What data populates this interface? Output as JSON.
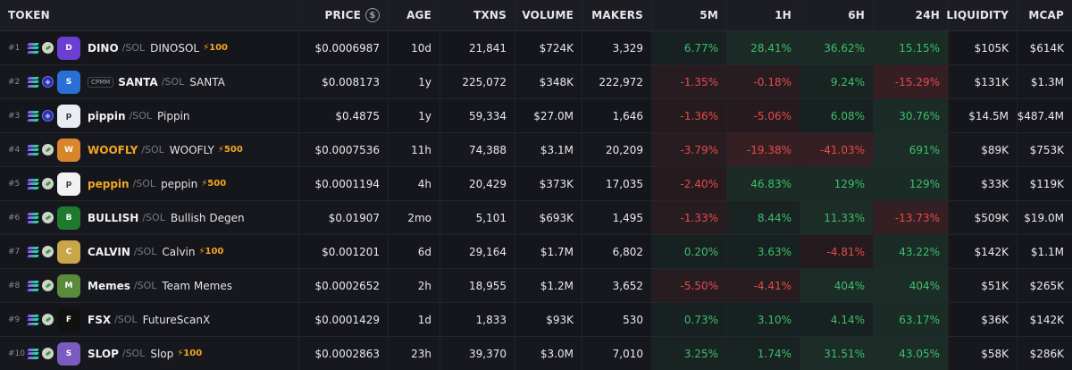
{
  "headers": {
    "token": "TOKEN",
    "price": "PRICE",
    "price_icon": "$",
    "age": "AGE",
    "txns": "TXNS",
    "volume": "VOLUME",
    "makers": "MAKERS",
    "m5": "5M",
    "h1": "1H",
    "h6": "6H",
    "h24": "24H",
    "liquidity": "LIQUIDITY",
    "mcap": "MCAP"
  },
  "rows": [
    {
      "rank": "#1",
      "dex": "pump",
      "cpmm": "",
      "symbol": "DINO",
      "chain": "/SOL",
      "name": "DINOSOL",
      "boost": "⚡100",
      "logo_color": "#6b3fd1",
      "logo_text": "D",
      "price": "$0.0006987",
      "age": "10d",
      "txns": "21,841",
      "volume": "$724K",
      "makers": "3,329",
      "m5": "6.77%",
      "h1": "28.41%",
      "h6": "36.62%",
      "h24": "15.15%",
      "liquidity": "$105K",
      "mcap": "$614K"
    },
    {
      "rank": "#2",
      "dex": "raydium",
      "cpmm": "CPMM",
      "symbol": "SANTA",
      "chain": "/SOL",
      "name": "SANTA",
      "boost": "",
      "logo_color": "#2a6fd6",
      "logo_text": "S",
      "price": "$0.008173",
      "age": "1y",
      "txns": "225,072",
      "volume": "$348K",
      "makers": "222,972",
      "m5": "-1.35%",
      "h1": "-0.18%",
      "h6": "9.24%",
      "h24": "-15.29%",
      "liquidity": "$131K",
      "mcap": "$1.3M"
    },
    {
      "rank": "#3",
      "dex": "raydium",
      "cpmm": "",
      "symbol": "pippin",
      "chain": "/SOL",
      "name": "Pippin",
      "boost": "",
      "logo_color": "#e9edf2",
      "logo_text": "p",
      "price": "$0.4875",
      "age": "1y",
      "txns": "59,334",
      "volume": "$27.0M",
      "makers": "1,646",
      "m5": "-1.36%",
      "h1": "-5.06%",
      "h6": "6.08%",
      "h24": "30.76%",
      "liquidity": "$14.5M",
      "mcap": "$487.4M"
    },
    {
      "rank": "#4",
      "dex": "pump",
      "cpmm": "",
      "symbol": "WOOFLY",
      "chain": "/SOL",
      "name": "WOOFLY",
      "boost": "⚡500",
      "logo_color": "#d9852b",
      "logo_text": "W",
      "price": "$0.0007536",
      "age": "11h",
      "txns": "74,388",
      "volume": "$3.1M",
      "makers": "20,209",
      "m5": "-3.79%",
      "h1": "-19.38%",
      "h6": "-41.03%",
      "h24": "691%",
      "liquidity": "$89K",
      "mcap": "$753K"
    },
    {
      "rank": "#5",
      "dex": "pump",
      "cpmm": "",
      "symbol": "peppin",
      "chain": "/SOL",
      "name": "peppin",
      "boost": "⚡500",
      "logo_color": "#f2f2f2",
      "logo_text": "p",
      "price": "$0.0001194",
      "age": "4h",
      "txns": "20,429",
      "volume": "$373K",
      "makers": "17,035",
      "m5": "-2.40%",
      "h1": "46.83%",
      "h6": "129%",
      "h24": "129%",
      "liquidity": "$33K",
      "mcap": "$119K"
    },
    {
      "rank": "#6",
      "dex": "pump",
      "cpmm": "",
      "symbol": "BULLISH",
      "chain": "/SOL",
      "name": "Bullish Degen",
      "boost": "",
      "logo_color": "#1f7a2e",
      "logo_text": "B",
      "price": "$0.01907",
      "age": "2mo",
      "txns": "5,101",
      "volume": "$693K",
      "makers": "1,495",
      "m5": "-1.33%",
      "h1": "8.44%",
      "h6": "11.33%",
      "h24": "-13.73%",
      "liquidity": "$509K",
      "mcap": "$19.0M"
    },
    {
      "rank": "#7",
      "dex": "pump",
      "cpmm": "",
      "symbol": "CALVIN",
      "chain": "/SOL",
      "name": "Calvin",
      "boost": "⚡100",
      "logo_color": "#c9a64a",
      "logo_text": "C",
      "price": "$0.001201",
      "age": "6d",
      "txns": "29,164",
      "volume": "$1.7M",
      "makers": "6,802",
      "m5": "0.20%",
      "h1": "3.63%",
      "h6": "-4.81%",
      "h24": "43.22%",
      "liquidity": "$142K",
      "mcap": "$1.1M"
    },
    {
      "rank": "#8",
      "dex": "pump",
      "cpmm": "",
      "symbol": "Memes",
      "chain": "/SOL",
      "name": "Team Memes",
      "boost": "",
      "logo_color": "#5a8a3a",
      "logo_text": "M",
      "price": "$0.0002652",
      "age": "2h",
      "txns": "18,955",
      "volume": "$1.2M",
      "makers": "3,652",
      "m5": "-5.50%",
      "h1": "-4.41%",
      "h6": "404%",
      "h24": "404%",
      "liquidity": "$51K",
      "mcap": "$265K"
    },
    {
      "rank": "#9",
      "dex": "pump",
      "cpmm": "",
      "symbol": "FSX",
      "chain": "/SOL",
      "name": "FutureScanX",
      "boost": "",
      "logo_color": "#111111",
      "logo_text": "F",
      "price": "$0.0001429",
      "age": "1d",
      "txns": "1,833",
      "volume": "$93K",
      "makers": "530",
      "m5": "0.73%",
      "h1": "3.10%",
      "h6": "4.14%",
      "h24": "63.17%",
      "liquidity": "$36K",
      "mcap": "$142K"
    },
    {
      "rank": "#10",
      "dex": "pump",
      "cpmm": "",
      "symbol": "SLOP",
      "chain": "/SOL",
      "name": "Slop",
      "boost": "⚡100",
      "logo_color": "#7a5bbf",
      "logo_text": "S",
      "price": "$0.0002863",
      "age": "23h",
      "txns": "39,370",
      "volume": "$3.0M",
      "makers": "7,010",
      "m5": "3.25%",
      "h1": "1.74%",
      "h6": "31.51%",
      "h24": "43.05%",
      "liquidity": "$58K",
      "mcap": "$286K"
    }
  ],
  "colors": {
    "positive": "#3fbf6b",
    "negative": "#e64c4c",
    "boost": "#f5a623",
    "background": "#15161b"
  }
}
